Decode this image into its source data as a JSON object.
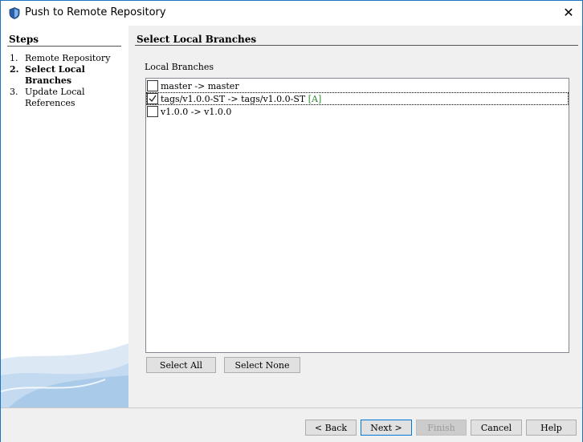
{
  "window": {
    "title": "Push to Remote Repository"
  },
  "steps": {
    "header": "Steps",
    "items": [
      {
        "num": "1.",
        "label_lines": [
          "Remote Repository"
        ],
        "current": false
      },
      {
        "num": "2.",
        "label_lines": [
          "Select Local",
          "Branches"
        ],
        "current": true
      },
      {
        "num": "3.",
        "label_lines": [
          "Update Local",
          "References"
        ],
        "current": false
      }
    ]
  },
  "page": {
    "title": "Select Local Branches",
    "list_label": "Local Branches",
    "branches": [
      {
        "text": "master -> master",
        "tag": "",
        "checked": false,
        "selected": false
      },
      {
        "text": "tags/v1.0.0-ST -> tags/v1.0.0-ST ",
        "tag": "[A]",
        "checked": true,
        "selected": true
      },
      {
        "text": "v1.0.0 -> v1.0.0",
        "tag": "",
        "checked": false,
        "selected": false
      }
    ],
    "select_all_label": "Select All",
    "select_none_label": "Select None"
  },
  "footer": {
    "back_label": "< Back",
    "next_label": "Next >",
    "finish_label": "Finish",
    "cancel_label": "Cancel",
    "help_label": "Help"
  },
  "colors": {
    "accent": "#0078d7",
    "tag_green": "#2e8b2e"
  }
}
